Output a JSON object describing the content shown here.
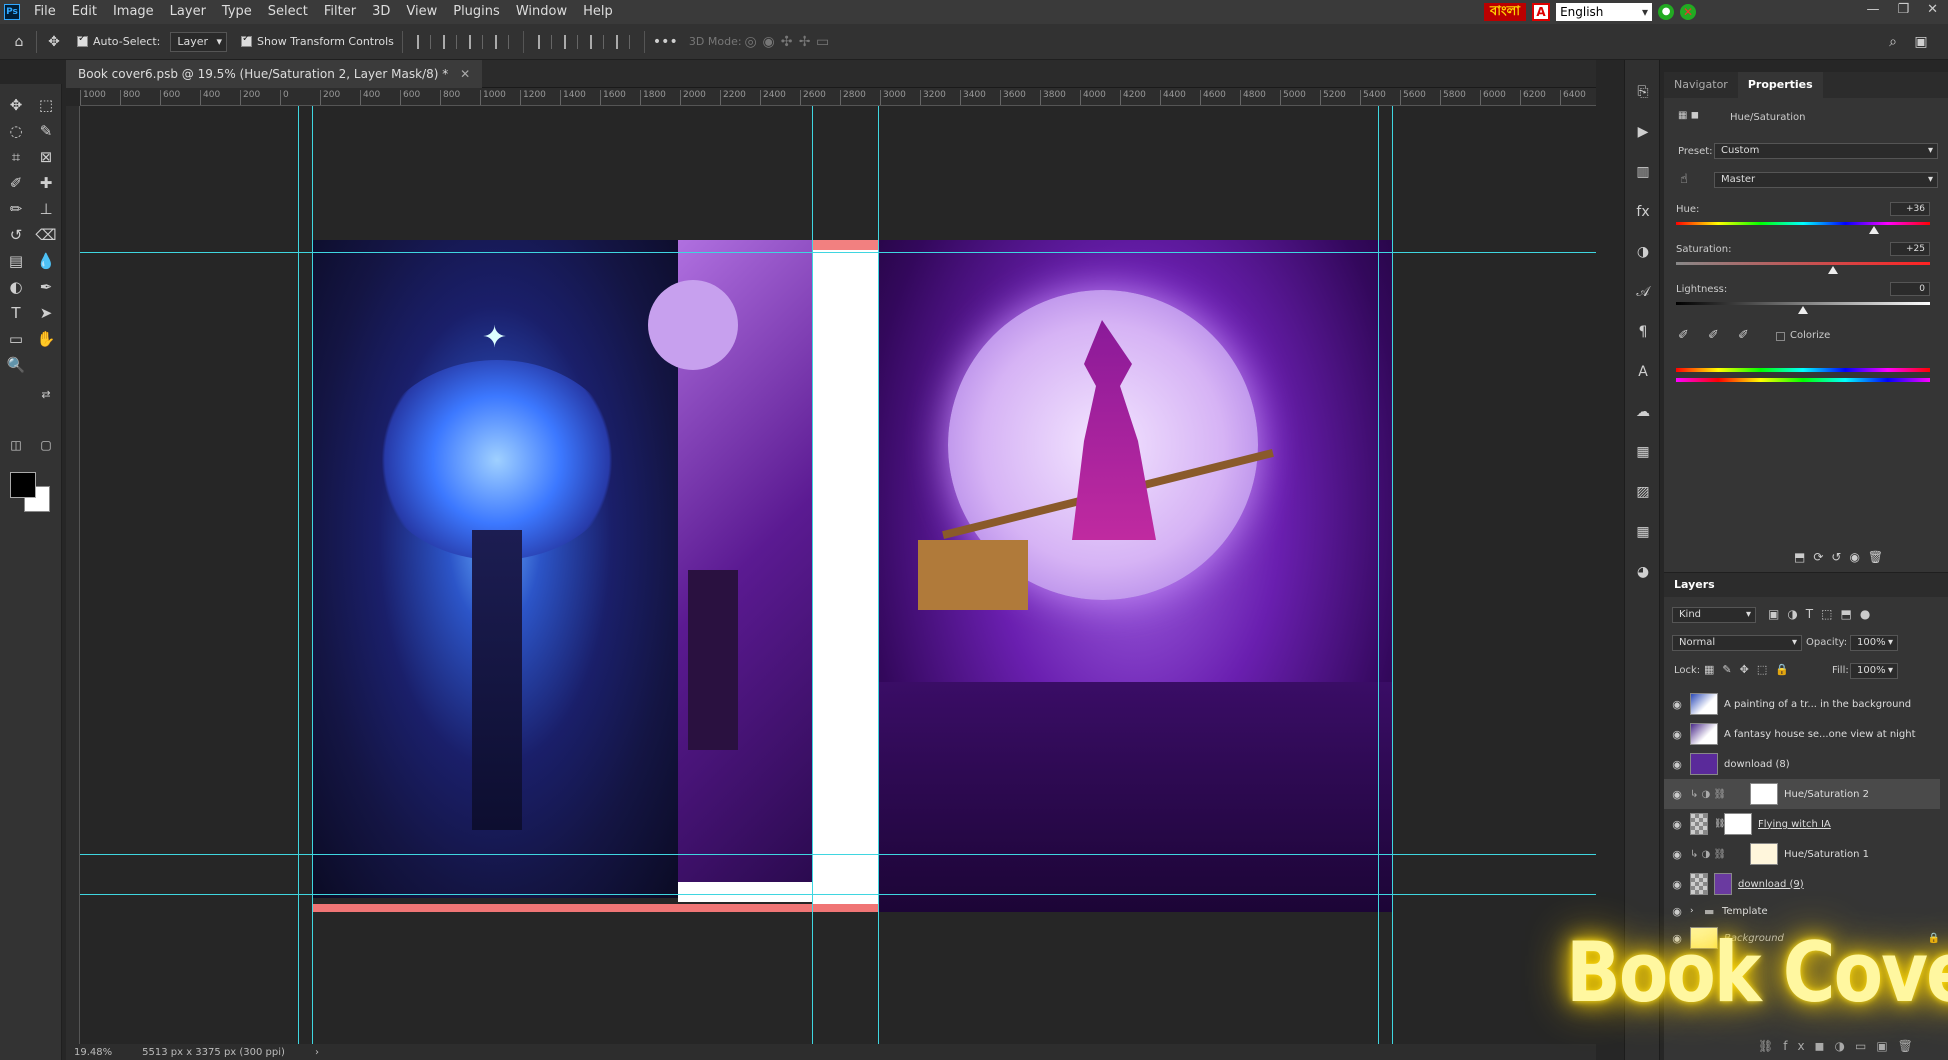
{
  "menubar": {
    "items": [
      "File",
      "Edit",
      "Image",
      "Layer",
      "Type",
      "Select",
      "Filter",
      "3D",
      "View",
      "Plugins",
      "Window",
      "Help"
    ],
    "bangla_label": "বাংলা",
    "language": "English",
    "ps_logo": "Ps"
  },
  "optbar": {
    "auto_select_label": "Auto-Select:",
    "layer_option": "Layer",
    "show_transform": "Show Transform Controls",
    "mode_label": "3D Mode:"
  },
  "document": {
    "tab_title": "Book cover6.psb @ 19.5% (Hue/Saturation 2, Layer Mask/8) *"
  },
  "ruler": {
    "top_ticks": [
      "1000",
      "800",
      "600",
      "400",
      "200",
      "0",
      "200",
      "400",
      "600",
      "800",
      "1000",
      "1200",
      "1400",
      "1600",
      "1800",
      "2000",
      "2200",
      "2400",
      "2600",
      "2800",
      "3000",
      "3200",
      "3400",
      "3600",
      "3800",
      "4000",
      "4200",
      "4400",
      "4600",
      "4800",
      "5000",
      "5200",
      "5400",
      "5600",
      "5800",
      "6000",
      "6200",
      "6400"
    ]
  },
  "status": {
    "zoom": "19.48%",
    "size": "5513 px x 3375 px (300 ppi)"
  },
  "properties": {
    "tab_navigator": "Navigator",
    "tab_properties": "Properties",
    "adjustment": "Hue/Saturation",
    "preset_label": "Preset:",
    "preset_value": "Custom",
    "channel": "Master",
    "hue_label": "Hue:",
    "hue_value": "+36",
    "hue_fraction": 0.78,
    "sat_label": "Saturation:",
    "sat_value": "+25",
    "sat_fraction": 0.62,
    "light_label": "Lightness:",
    "light_value": "0",
    "light_fraction": 0.5,
    "colorize": "Colorize"
  },
  "layers": {
    "title": "Layers",
    "kind": "Kind",
    "blend": "Normal",
    "opacity_label": "Opacity:",
    "opacity": "100%",
    "lock_label": "Lock:",
    "fill_label": "Fill:",
    "fill": "100%",
    "items": [
      {
        "name": "A painting of a tr... in the background"
      },
      {
        "name": "A fantasy house se...one view at night"
      },
      {
        "name": "download (8)"
      },
      {
        "name": "Hue/Saturation 2"
      },
      {
        "name": "Flying witch IA"
      },
      {
        "name": "Hue/Saturation 1"
      },
      {
        "name": "download (9)"
      },
      {
        "name": "Template"
      },
      {
        "name": "Background"
      }
    ]
  },
  "overlay": {
    "text": "Book Cover!"
  },
  "colors": {
    "guide": "#3fd6e0",
    "bleed": "#f07575"
  }
}
